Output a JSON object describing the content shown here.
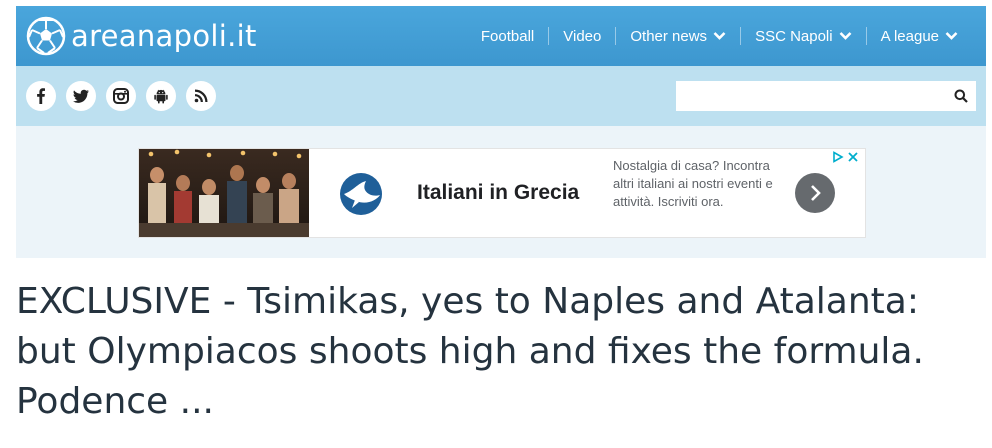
{
  "site": {
    "name": "areanapoli.it"
  },
  "nav": {
    "items": [
      {
        "label": "Football",
        "dropdown": false
      },
      {
        "label": "Video",
        "dropdown": false
      },
      {
        "label": "Other news",
        "dropdown": true
      },
      {
        "label": "SSC Napoli",
        "dropdown": true
      },
      {
        "label": "A league",
        "dropdown": true
      }
    ]
  },
  "social": [
    "facebook-icon",
    "twitter-icon",
    "instagram-icon",
    "android-icon",
    "rss-icon"
  ],
  "search": {
    "value": "",
    "placeholder": ""
  },
  "ad": {
    "title": "Italiani in Grecia",
    "text": "Nostalgia di casa? Incontra altri italiani ai nostri eventi e attività. Iscriviti ora."
  },
  "article": {
    "headline": "EXCLUSIVE - Tsimikas, yes to Naples and Atalanta: but Olympiacos shoots high and fixes the formula. Podence ..."
  },
  "colors": {
    "header": "#3d97cf",
    "subbar": "#bde0f0",
    "adzone": "#ecf4f9",
    "headline": "#25333f"
  }
}
